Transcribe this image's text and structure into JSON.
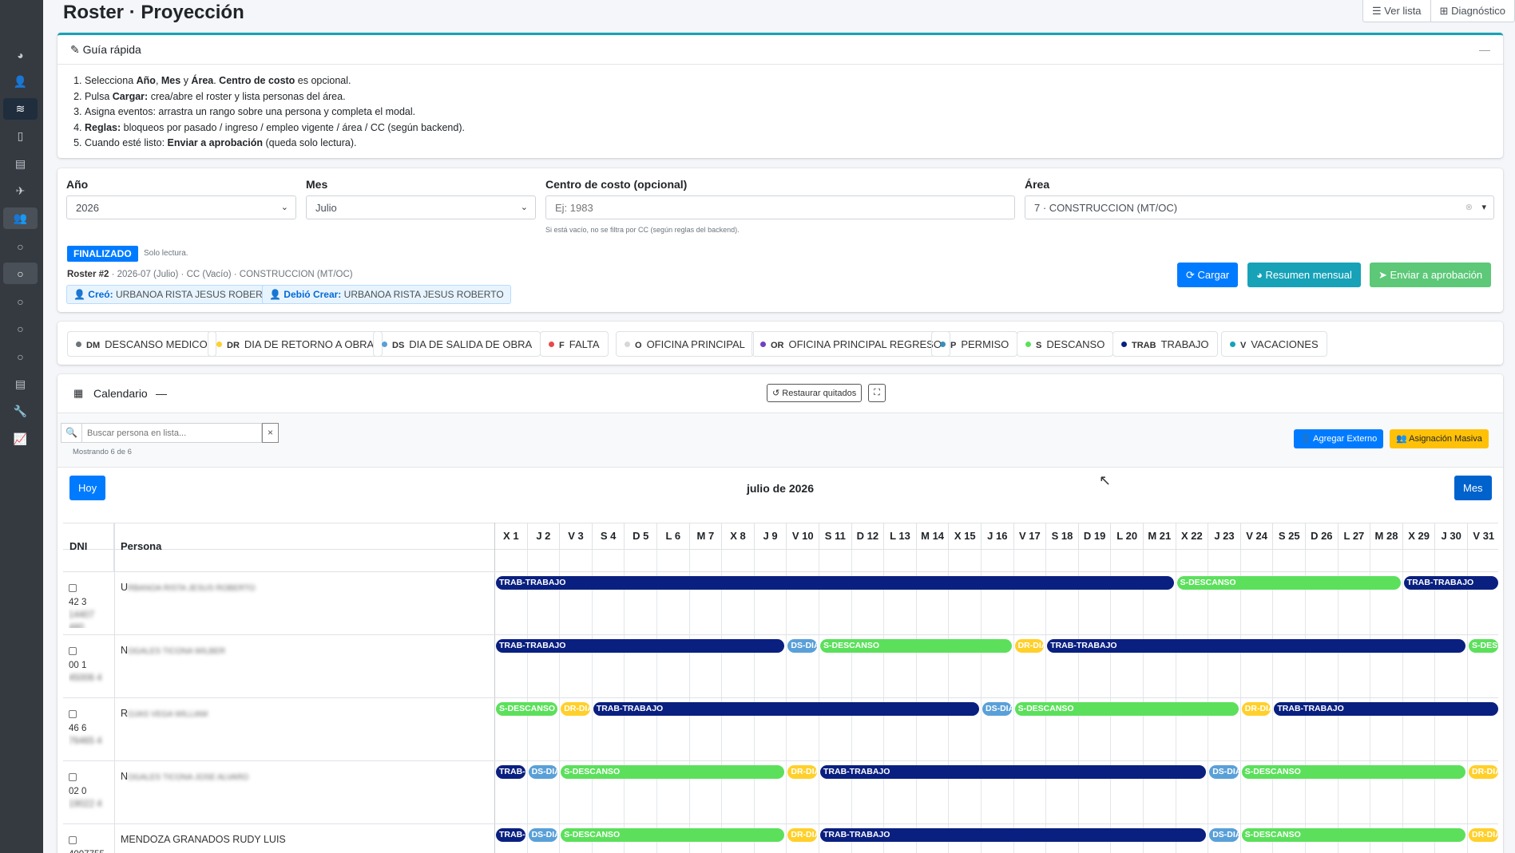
{
  "page": {
    "title": "Roster · Proyección"
  },
  "top_buttons": {
    "list": "Ver lista",
    "diag": "Diagnóstico"
  },
  "sidebar": {
    "icons": [
      "chart-pie-icon",
      "user-cog-icon",
      "layers-icon",
      "mobile-icon",
      "clipboard-icon",
      "plane-icon",
      "users-icon",
      "circle-icon",
      "circle-icon",
      "circle-icon",
      "circle-icon",
      "circle-icon",
      "clipboard-icon",
      "wrench-icon",
      "chart-line-icon"
    ]
  },
  "guide": {
    "title": "Guía rápida",
    "collapse": "—",
    "steps": [
      [
        "Selecciona ",
        "Año",
        ", ",
        "Mes",
        " y ",
        "Área",
        ". ",
        "Centro de costo",
        " es opcional."
      ],
      [
        "Pulsa ",
        "Cargar:",
        " crea/abre el roster y lista personas del área."
      ],
      [
        "Asigna eventos: arrastra un rango sobre una persona y completa el modal."
      ],
      [
        "Reglas:",
        " bloqueos por pasado / ingreso / empleo vigente / área / CC (según backend)."
      ],
      [
        "Cuando esté listo: ",
        "Enviar a aprobación",
        " (queda solo lectura)."
      ]
    ]
  },
  "filters": {
    "year_label": "Año",
    "year": "2026",
    "month_label": "Mes",
    "month": "Julio",
    "cc_label": "Centro de costo (opcional)",
    "cc_placeholder": "Ej: 1983",
    "cc_help": "Si está vacío, no se filtra por CC (según reglas del backend).",
    "area_label": "Área",
    "area": "7 · CONSTRUCCION (MT/OC)"
  },
  "status": {
    "badge": "FINALIZADO",
    "readonly": "Solo lectura.",
    "roster_id": "Roster #2",
    "roster_info": " · 2026-07 (Julio) · CC (Vacío) · CONSTRUCCION (MT/OC)",
    "created_label": "Creó:",
    "created_by": "URBANOA RISTA JESUS ROBERTO",
    "should_label": "Debió Crear:",
    "should_by": "URBANOA RISTA JESUS ROBERTO"
  },
  "actions": {
    "load": "Cargar",
    "summary": "Resumen mensual",
    "send": "Enviar a aprobación"
  },
  "legend": [
    {
      "code": "DM",
      "label": "DESCANSO MEDICO",
      "color": "#6c757d"
    },
    {
      "code": "DR",
      "label": "DIA DE RETORNO A OBRA",
      "color": "#ffd02b"
    },
    {
      "code": "DS",
      "label": "DIA DE SALIDA DE OBRA",
      "color": "#5aa0d8"
    },
    {
      "code": "F",
      "label": "FALTA",
      "color": "#e74a4a"
    },
    {
      "code": "O",
      "label": "OFICINA PRINCIPAL",
      "color": "#d7d7d7"
    },
    {
      "code": "OR",
      "label": "OFICINA PRINCIPAL REGRESO",
      "color": "#6f42c1"
    },
    {
      "code": "P",
      "label": "PERMISO",
      "color": "#3c8dbc"
    },
    {
      "code": "S",
      "label": "DESCANSO",
      "color": "#5ce05c"
    },
    {
      "code": "TRAB",
      "label": "TRABAJO",
      "color": "#0a2080"
    },
    {
      "code": "V",
      "label": "VACACIONES",
      "color": "#17a2b8"
    }
  ],
  "calendar": {
    "title": "Calendario",
    "dash": "—",
    "restore": "Restaurar quitados",
    "search_placeholder": "Buscar persona en lista...",
    "clear": "×",
    "showing": "Mostrando 6 de 6",
    "add_external": "Agregar Externo",
    "bulk": "Asignación Masiva",
    "today": "Hoy",
    "month_title": "julio de 2026",
    "view": "Mes",
    "col_dni": "DNI",
    "col_person": "Persona",
    "days": [
      "X 1",
      "J 2",
      "V 3",
      "S 4",
      "D 5",
      "L 6",
      "M 7",
      "X 8",
      "J 9",
      "V 10",
      "S 11",
      "D 12",
      "L 13",
      "M 14",
      "X 15",
      "J 16",
      "V 17",
      "S 18",
      "D 19",
      "L 20",
      "M 21",
      "X 22",
      "J 23",
      "V 24",
      "S 25",
      "D 26",
      "L 27",
      "M 28",
      "X 29",
      "J 30",
      "V 31"
    ]
  },
  "rows": [
    {
      "dni": "42 3",
      "dni_hidden": "14407 480",
      "name_prefix": "U",
      "name_hidden": "RBANOA RISTA JESUS ROBERTO"
    },
    {
      "dni": "00 1",
      "dni_hidden": "45006 4",
      "name_prefix": "N",
      "name_hidden": "OGALES TICONA WILBER"
    },
    {
      "dni": "46 6",
      "dni_hidden": "76465 4",
      "name_prefix": "R",
      "name_hidden": "OJAS VEGA WILLIAM"
    },
    {
      "dni": "02 0",
      "dni_hidden": "19022 4",
      "name_prefix": "N",
      "name_hidden": "OGALES TICONA JOSE ALVARO"
    },
    {
      "dni": "4007755",
      "dni_hidden": "",
      "name_prefix": "MENDOZA GRANADOS RUDY LUIS",
      "name_hidden": ""
    }
  ],
  "events": [
    [
      {
        "t": "TRAB-TRABAJO",
        "s": 1,
        "e": 21,
        "c": "#0a2080"
      },
      {
        "t": "S-DESCANSO",
        "s": 22,
        "e": 28,
        "c": "#5ce05c"
      },
      {
        "t": "TRAB-TRABAJO",
        "s": 29,
        "e": 31,
        "c": "#0a2080"
      }
    ],
    [
      {
        "t": "TRAB-TRABAJO",
        "s": 1,
        "e": 9,
        "c": "#0a2080"
      },
      {
        "t": "DS-DIA",
        "s": 10,
        "e": 10,
        "c": "#5aa0d8"
      },
      {
        "t": "S-DESCANSO",
        "s": 11,
        "e": 16,
        "c": "#5ce05c"
      },
      {
        "t": "DR-DIA",
        "s": 17,
        "e": 17,
        "c": "#ffd02b"
      },
      {
        "t": "TRAB-TRABAJO",
        "s": 18,
        "e": 30,
        "c": "#0a2080"
      },
      {
        "t": "S-DESC",
        "s": 31,
        "e": 31,
        "c": "#5ce05c"
      }
    ],
    [
      {
        "t": "S-DESCANSO",
        "s": 1,
        "e": 2,
        "c": "#5ce05c"
      },
      {
        "t": "DR-DIA",
        "s": 3,
        "e": 3,
        "c": "#ffd02b"
      },
      {
        "t": "TRAB-TRABAJO",
        "s": 4,
        "e": 15,
        "c": "#0a2080"
      },
      {
        "t": "DS-DIA",
        "s": 16,
        "e": 16,
        "c": "#5aa0d8"
      },
      {
        "t": "S-DESCANSO",
        "s": 17,
        "e": 23,
        "c": "#5ce05c"
      },
      {
        "t": "DR-DIA",
        "s": 24,
        "e": 24,
        "c": "#ffd02b"
      },
      {
        "t": "TRAB-TRABAJO",
        "s": 25,
        "e": 31,
        "c": "#0a2080"
      }
    ],
    [
      {
        "t": "TRAB-TRABAJO",
        "s": 1,
        "e": 1,
        "c": "#0a2080"
      },
      {
        "t": "DS-DIA",
        "s": 2,
        "e": 2,
        "c": "#5aa0d8"
      },
      {
        "t": "S-DESCANSO",
        "s": 3,
        "e": 9,
        "c": "#5ce05c"
      },
      {
        "t": "DR-DIA",
        "s": 10,
        "e": 10,
        "c": "#ffd02b"
      },
      {
        "t": "TRAB-TRABAJO",
        "s": 11,
        "e": 22,
        "c": "#0a2080"
      },
      {
        "t": "DS-DIA",
        "s": 23,
        "e": 23,
        "c": "#5aa0d8"
      },
      {
        "t": "S-DESCANSO",
        "s": 24,
        "e": 30,
        "c": "#5ce05c"
      },
      {
        "t": "DR-DIA",
        "s": 31,
        "e": 31,
        "c": "#ffd02b"
      }
    ],
    [
      {
        "t": "TRAB-TRABAJO",
        "s": 1,
        "e": 1,
        "c": "#0a2080"
      },
      {
        "t": "DS-DIA",
        "s": 2,
        "e": 2,
        "c": "#5aa0d8"
      },
      {
        "t": "S-DESCANSO",
        "s": 3,
        "e": 9,
        "c": "#5ce05c"
      },
      {
        "t": "DR-DIA",
        "s": 10,
        "e": 10,
        "c": "#ffd02b"
      },
      {
        "t": "TRAB-TRABAJO",
        "s": 11,
        "e": 22,
        "c": "#0a2080"
      },
      {
        "t": "DS-DIA",
        "s": 23,
        "e": 23,
        "c": "#5aa0d8"
      },
      {
        "t": "S-DESCANSO",
        "s": 24,
        "e": 30,
        "c": "#5ce05c"
      },
      {
        "t": "DR-DIA",
        "s": 31,
        "e": 31,
        "c": "#ffd02b"
      }
    ]
  ]
}
